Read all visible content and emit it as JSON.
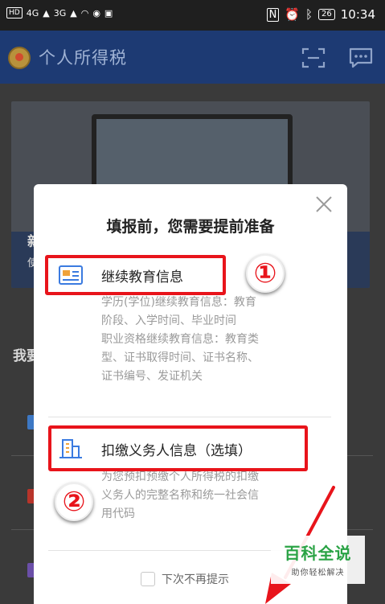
{
  "status_bar": {
    "left_badge": "HD",
    "network_1": "4G",
    "network_2": "3G",
    "battery": "26",
    "time": "10:34"
  },
  "app_bar": {
    "title": "个人所得税",
    "icons": [
      "scan-icon",
      "message-icon"
    ]
  },
  "background": {
    "section_fragment": "我要",
    "banner_char": "新",
    "banner_char_2": "使"
  },
  "modal": {
    "title": "填报前，您需要提前准备",
    "sections": [
      {
        "title": "继续教育信息",
        "icon": "id-card-icon",
        "desc_lines": [
          "学历(学位)继续教育信息：教育",
          "阶段、入学时间、毕业时间",
          "职业资格继续教育信息：教育类",
          "型、证书取得时间、证书名称、",
          "证书编号、发证机关"
        ]
      },
      {
        "title": "扣缴义务人信息（选填）",
        "icon": "building-icon",
        "desc_lines": [
          "为您预扣预缴个人所得税的扣缴",
          "义务人的完整名称和统一社会信",
          "用代码"
        ]
      }
    ],
    "checkbox_label": "下次不再提示"
  },
  "annotations": {
    "badge_1": "①",
    "badge_2": "②",
    "highlight_color": "#e8141b"
  },
  "watermark": {
    "main": "百科全说",
    "sub": "助你轻松解决"
  },
  "colors": {
    "app_bar": "#1d3a73",
    "icon_blue": "#3b7be0",
    "watermark_green": "#2aa345"
  }
}
